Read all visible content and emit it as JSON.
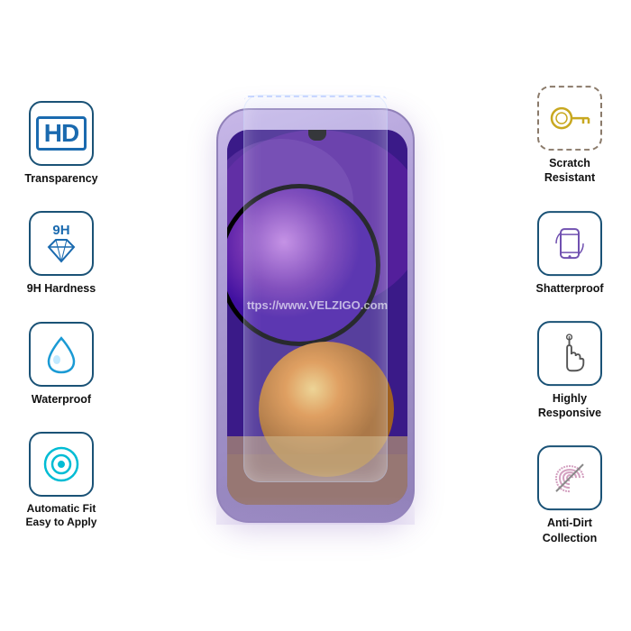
{
  "features": {
    "left": [
      {
        "id": "hd-transparency",
        "icon": "hd",
        "label": "Transparency"
      },
      {
        "id": "9h-hardness",
        "icon": "diamond",
        "label": "9H Hardness"
      },
      {
        "id": "waterproof",
        "icon": "drop",
        "label": "Waterproof"
      },
      {
        "id": "auto-fit",
        "icon": "circle-target",
        "label": "Automatic Fit\nEasy to Apply"
      }
    ],
    "right": [
      {
        "id": "scratch-resistant",
        "icon": "key",
        "label": "Scratch\nResistant"
      },
      {
        "id": "shatterproof",
        "icon": "phone-rotate",
        "label": "Shatterproof"
      },
      {
        "id": "highly-responsive",
        "icon": "hand-touch",
        "label": "Highly\nResponsive"
      },
      {
        "id": "anti-dirt",
        "icon": "fingerprint",
        "label": "Anti-Dirt\nCollection"
      }
    ]
  },
  "watermark": "ttps://www.VELZIGO.com",
  "watermark2": "https://www.V",
  "brand": "VELZIGO"
}
